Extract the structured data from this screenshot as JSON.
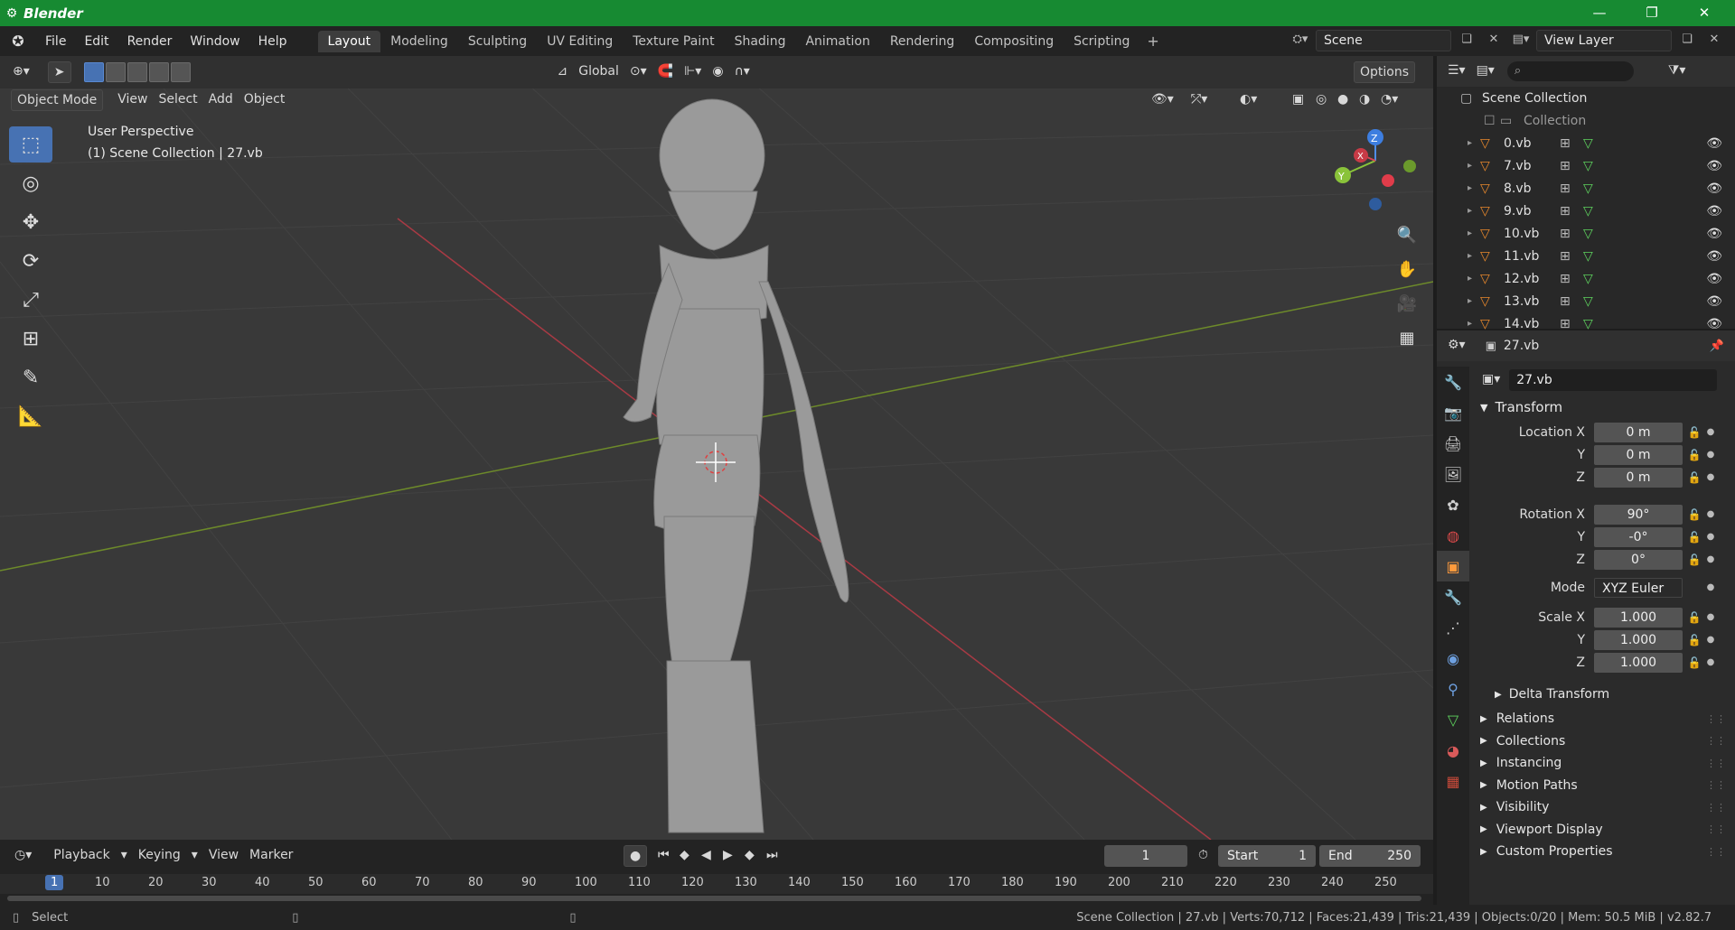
{
  "window": {
    "title": "Blender"
  },
  "menu": {
    "items": [
      "File",
      "Edit",
      "Render",
      "Window",
      "Help"
    ]
  },
  "workspaces": [
    "Layout",
    "Modeling",
    "Sculpting",
    "UV Editing",
    "Texture Paint",
    "Shading",
    "Animation",
    "Rendering",
    "Compositing",
    "Scripting"
  ],
  "active_workspace": "Layout",
  "scene": {
    "name": "Scene",
    "view_layer": "View Layer"
  },
  "header": {
    "orientation": "Global",
    "options": "Options"
  },
  "viewport_header": {
    "mode": "Object Mode",
    "menus": [
      "View",
      "Select",
      "Add",
      "Object"
    ]
  },
  "viewport": {
    "perspective": "User Perspective",
    "context": "(1) Scene Collection | 27.vb"
  },
  "gizmo": {
    "z": "Z",
    "y": "Y",
    "x": "X"
  },
  "timeline": {
    "menus": [
      "Playback",
      "Keying",
      "View",
      "Marker"
    ],
    "current_frame": "1",
    "start_label": "Start",
    "start": "1",
    "end_label": "End",
    "end": "250",
    "ticks": [
      "1",
      "10",
      "20",
      "30",
      "40",
      "50",
      "60",
      "70",
      "80",
      "90",
      "100",
      "110",
      "120",
      "130",
      "140",
      "150",
      "160",
      "170",
      "180",
      "190",
      "200",
      "210",
      "220",
      "230",
      "240",
      "250"
    ]
  },
  "status": {
    "left": "Select",
    "right": "Scene Collection | 27.vb | Verts:70,712 | Faces:21,439 | Tris:21,439 | Objects:0/20 | Mem: 50.5 MiB | v2.82.7"
  },
  "outliner": {
    "root": "Scene Collection",
    "collection": "Collection",
    "objects": [
      "0.vb",
      "7.vb",
      "8.vb",
      "9.vb",
      "10.vb",
      "11.vb",
      "12.vb",
      "13.vb",
      "14.vb"
    ]
  },
  "properties": {
    "object_name": "27.vb",
    "datablock": "27.vb",
    "transform_title": "Transform",
    "location_label": "Location X",
    "location": [
      "0 m",
      "0 m",
      "0 m"
    ],
    "rotation_label": "Rotation X",
    "rotation": [
      "90°",
      "-0°",
      "0°"
    ],
    "mode_label": "Mode",
    "mode": "XYZ Euler",
    "scale_label": "Scale X",
    "scale": [
      "1.000",
      "1.000",
      "1.000"
    ],
    "axis_y": "Y",
    "axis_z": "Z",
    "delta": "Delta Transform",
    "panels": [
      "Relations",
      "Collections",
      "Instancing",
      "Motion Paths",
      "Visibility",
      "Viewport Display",
      "Custom Properties"
    ]
  },
  "colors": {
    "title_bar": "#178a32",
    "accent": "#4772b3",
    "object_orange": "#e8882c",
    "mesh_green": "#5ed35e"
  }
}
